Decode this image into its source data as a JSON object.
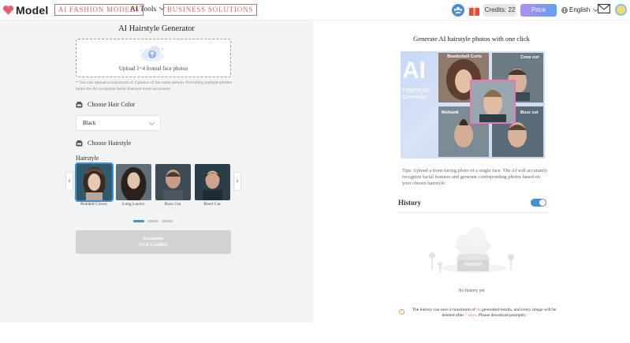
{
  "header": {
    "logo_text": "Model",
    "nav": {
      "ai_fashion_models": "AI FASHION MODELS",
      "ai_tools": "AI Tools",
      "business_solutions": "BUSINESS SOLUTIONS"
    },
    "credits": "Credits: 22",
    "price": "Price",
    "language": "English"
  },
  "left": {
    "title": "AI Hairstyle Generator",
    "upload_text": "Upload 1~4 frontal face photos",
    "note": "* You can upload a maximum of 4 photos of the same person. Providing multiple photos helps the AI recognize facial features more accurately.",
    "hair_color_heading": "Choose Hair Color",
    "hair_color_value": "Black",
    "hairstyle_heading": "Choose Hairstyle",
    "hairstyle_tab_label": "Hairstyle",
    "hairstyles": [
      {
        "label": "Braided Crown",
        "selected": true
      },
      {
        "label": "Long Layers",
        "selected": false
      },
      {
        "label": "Buzz Cut",
        "selected": false
      },
      {
        "label": "Bowl Cut",
        "selected": false
      }
    ],
    "generate_label": "Generate",
    "generate_credits": "(5+8 Credits)"
  },
  "right": {
    "title": "Generate AI hairstyle photos with one click",
    "collage_labels": {
      "ai": "AI",
      "hairstyle": "Hairstyle",
      "generator": "Generator",
      "bombshell_curls": "Bombshell Curls",
      "crew_cut": "Crew cut",
      "mohawk": "Mohawk",
      "buzz_cut": "Buzz cut"
    },
    "tips": "Tips: Upload a front-facing photo of a single face. The AI will accurately recognize facial features and generate corresponding photos based on your chosen hairstyle.",
    "history_title": "History",
    "history_toggle_on": true,
    "no_history": "No history yet",
    "warning_pre": "The history can save a maximum of ",
    "warning_count": "60",
    "warning_mid": " generated results, and every image will be deleted after ",
    "warning_days": "7 days",
    "warning_post": ". Please download promptly."
  },
  "colors": {
    "accent_pink": "#e5616f",
    "accent_blue": "#3f8fd9",
    "price_gradient_start": "#b08ff0",
    "price_gradient_end": "#5ea0f0"
  }
}
